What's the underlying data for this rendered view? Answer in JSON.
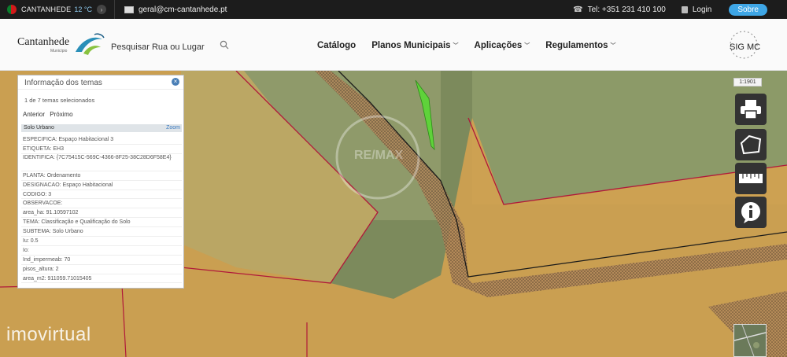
{
  "topbar": {
    "city": "CANTANHEDE",
    "temperature": "12 °C",
    "email": "geral@cm-cantanhede.pt",
    "phone": "Tel: +351 231 410 100",
    "login": "Login",
    "about": "Sobre"
  },
  "header": {
    "logo_text": "Cantanhede",
    "logo_sub": "Município",
    "search_label": "Pesquisar Rua ou Lugar",
    "nav": [
      {
        "label": "Catálogo",
        "dropdown": false
      },
      {
        "label": "Planos Municipais",
        "dropdown": true
      },
      {
        "label": "Aplicações",
        "dropdown": true
      },
      {
        "label": "Regulamentos",
        "dropdown": true
      }
    ],
    "sig_label": "SIG MC"
  },
  "panel": {
    "title": "Informação dos temas",
    "count": "1 de 7 temas selecionados",
    "prev": "Anterior",
    "next": "Próximo",
    "layer": "Solo Urbano",
    "zoom": "Zoom",
    "attributes": [
      "ESPECIFICA:  Espaço Habitacional 3",
      "ETIQUETA:  EH3",
      "IDENTIFICA:  {7C75415C-569C-4366-8F25-38C28D6F58E4}",
      "PLANTA:  Ordenamento",
      "DESIGNACAO:  Espaço Habitacional",
      "CODIGO:  3",
      "OBSERVACOE:",
      "area_ha:  91.10597102",
      "TEMA:  Classificação e Qualificação do Solo",
      "SUBTEMA:  Solo Urbano",
      "Iu:  0.5",
      "Io:",
      "Ind_impermeab:  70",
      "pisos_altura:  2",
      "area_m2:  911059.71015405"
    ]
  },
  "map": {
    "scale": "1:1901",
    "watermark": "imovirtual",
    "tools": [
      "printer-icon",
      "polygon-measure-icon",
      "ruler-icon",
      "info-icon"
    ]
  },
  "colors": {
    "topbar_bg": "#1c1c1c",
    "accent_blue": "#3ea6e6",
    "urban_zone": "#d8a24f",
    "boundary_red": "#b0183a",
    "highlight_green": "#5fd23a"
  }
}
